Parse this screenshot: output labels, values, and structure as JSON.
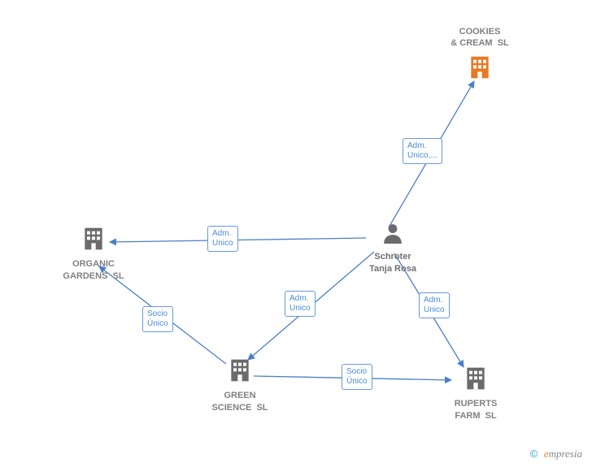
{
  "diagram": {
    "center": {
      "name": "Schroter\nTanja Rosa",
      "type": "person"
    },
    "nodes": {
      "cookies": {
        "label": "COOKIES\n& CREAM  SL",
        "color": "#e67a24"
      },
      "organic": {
        "label": "ORGANIC\nGARDENS  SL",
        "color": "#6b6b6b"
      },
      "green": {
        "label": "GREEN\nSCIENCE  SL",
        "color": "#6b6b6b"
      },
      "ruperts": {
        "label": "RUPERTS\nFARM  SL",
        "color": "#6b6b6b"
      }
    },
    "edges": {
      "to_cookies": "Adm.\nUnico,...",
      "to_organic": "Adm.\nUnico",
      "to_green": "Adm.\nUnico",
      "to_ruperts": "Adm.\nUnico",
      "green_to_organic": "Socio\nÚnico",
      "green_to_ruperts": "Socio\nÚnico"
    }
  },
  "watermark": {
    "copy": "©",
    "brand_e": "e",
    "brand_rest": "mpresia"
  }
}
